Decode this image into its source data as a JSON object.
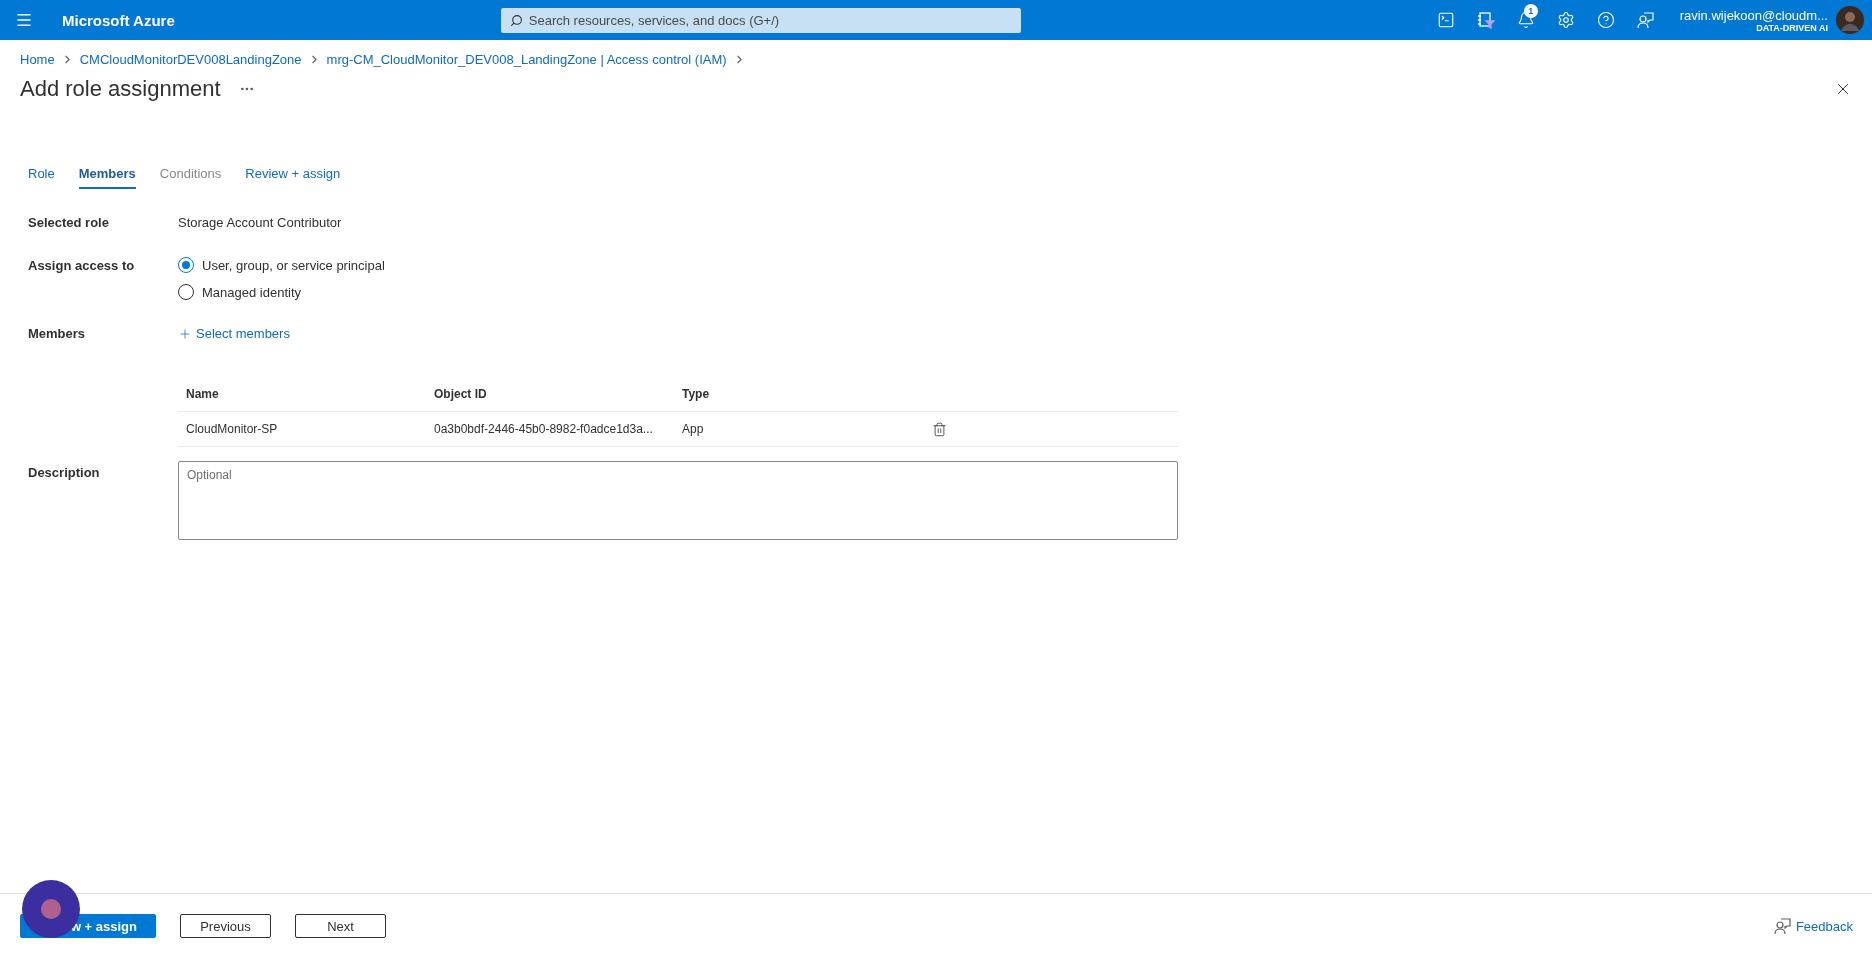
{
  "top_bar": {
    "brand": "Microsoft Azure",
    "search": {
      "placeholder": "Search resources, services, and docs (G+/)"
    },
    "notification_count": "1",
    "account": {
      "email": "ravin.wijekoon@cloudm...",
      "tenant": "DATA-DRIVEN AI"
    }
  },
  "breadcrumbs": [
    "Home",
    "CMCloudMonitorDEV008LandingZone",
    "mrg-CM_CloudMonitor_DEV008_LandingZone | Access control (IAM)"
  ],
  "title": "Add role assignment",
  "tabs": [
    {
      "label": "Role",
      "selected": false,
      "disabled": false
    },
    {
      "label": "Members",
      "selected": true,
      "disabled": false
    },
    {
      "label": "Conditions",
      "selected": false,
      "disabled": true
    },
    {
      "label": "Review + assign",
      "selected": false,
      "disabled": false
    }
  ],
  "form": {
    "selected_role": {
      "label": "Selected role",
      "value": "Storage Account Contributor"
    },
    "assign_access": {
      "label": "Assign access to",
      "options": [
        {
          "label": "User, group, or service principal",
          "selected": true
        },
        {
          "label": "Managed identity",
          "selected": false
        }
      ]
    },
    "members": {
      "label": "Members",
      "action": "Select members",
      "table": {
        "columns": [
          "Name",
          "Object ID",
          "Type"
        ],
        "rows": [
          {
            "cells": [
              "CloudMonitor-SP",
              "0a3b0bdf-2446-45b0-8982-f0adce1d3a...",
              "App"
            ]
          }
        ]
      }
    },
    "description": {
      "label": "Description",
      "placeholder": "Optional"
    }
  },
  "footer": {
    "buttons": [
      {
        "label": "w + assign",
        "kind": "primary"
      },
      {
        "label": "Previous",
        "kind": "secondary"
      },
      {
        "label": "Next",
        "kind": "secondary"
      }
    ],
    "feedback": "Feedback"
  }
}
